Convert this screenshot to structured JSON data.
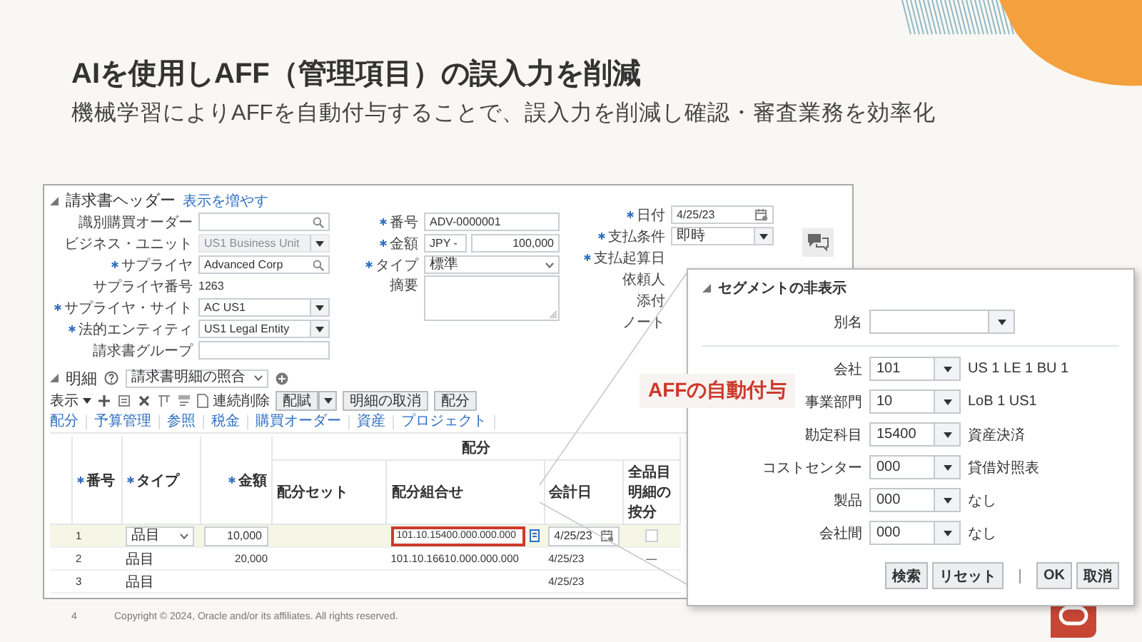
{
  "slide": {
    "title": "AIを使用しAFF（管理項目）の誤入力を削減",
    "subtitle": "機械学習によりAFFを自動付与することで、誤入力を削減し確認・審査業務を効率化"
  },
  "invoice": {
    "header": {
      "title": "請求書ヘッダー",
      "link": "表示を増やす",
      "left_fields": [
        {
          "label": "識別購買オーダー",
          "required": false,
          "kind": "search",
          "disabled": false
        },
        {
          "label": "ビジネス・ユニット",
          "required": false,
          "kind": "select",
          "value": "US1 Business Unit",
          "disabled": true
        },
        {
          "label": "サプライヤ",
          "required": true,
          "kind": "search",
          "value": "Advanced Corp",
          "disabled": false
        },
        {
          "label": "サプライヤ番号",
          "required": false,
          "kind": "text",
          "value": "1263",
          "disabled": false
        },
        {
          "label": "サプライヤ・サイト",
          "required": true,
          "kind": "select",
          "value": "AC US1",
          "disabled": false
        },
        {
          "label": "法的エンティティ",
          "required": true,
          "kind": "select",
          "value": "US1 Legal Entity",
          "disabled": false
        },
        {
          "label": "請求書グループ",
          "required": false,
          "kind": "input",
          "disabled": false
        }
      ],
      "middle_fields": [
        {
          "label": "番号",
          "required": true,
          "kind": "input",
          "value": "ADV-0000001"
        },
        {
          "label": "金額",
          "required": true,
          "kind": "currency",
          "currency": "JPY -",
          "value": "100,000"
        },
        {
          "label": "タイプ",
          "required": true,
          "kind": "dropdown",
          "value": "標準"
        },
        {
          "label": "摘要",
          "required": false,
          "kind": "textarea"
        }
      ],
      "right_fields": [
        {
          "label": "日付",
          "required": true,
          "kind": "date",
          "value": "4/25/23"
        },
        {
          "label": "支払条件",
          "required": true,
          "kind": "select",
          "value": "即時"
        },
        {
          "label": "支払起算日",
          "required": true,
          "kind": "label"
        },
        {
          "label": "依頼人",
          "required": false,
          "kind": "label"
        },
        {
          "label": "添付",
          "required": false,
          "kind": "label"
        },
        {
          "label": "ノート",
          "required": false,
          "kind": "label"
        }
      ]
    },
    "lines": {
      "title": "明細",
      "view_select": "請求書明細の照合",
      "view_menu": "表示",
      "toolbar_action": "連続削除",
      "buttons": [
        {
          "label": "配賦",
          "menu": true
        },
        {
          "label": "明細の取消",
          "menu": false
        },
        {
          "label": "配分",
          "menu": false
        }
      ],
      "tabs": [
        "配分",
        "予算管理",
        "参照",
        "税金",
        "購買オーダー",
        "資産",
        "プロジェクト"
      ],
      "table": {
        "group_heading": "配分",
        "columns": [
          {
            "label": "番号",
            "required": true,
            "group": false
          },
          {
            "label": "タイプ",
            "required": true,
            "group": false
          },
          {
            "label": "金額",
            "required": true,
            "group": false
          },
          {
            "label": "配分セット",
            "required": false,
            "group": true
          },
          {
            "label": "配分組合せ",
            "required": false,
            "group": true
          },
          {
            "label": "会計日",
            "required": false,
            "group": true
          },
          {
            "label": "全品目明細の按分",
            "required": false,
            "group": true
          }
        ],
        "rows": [
          {
            "selected": true,
            "editable": true,
            "number": "1",
            "type": "品目",
            "amount": "10,000",
            "combination": "101.10.15400.000.000.000",
            "highlighted": true,
            "accounting_date": "4/25/23",
            "prorate_checked": false
          },
          {
            "selected": false,
            "editable": false,
            "number": "2",
            "type": "品目",
            "amount": "20,000",
            "combination": "101.10.16610.000.000.000",
            "highlighted": false,
            "accounting_date": "4/25/23",
            "prorate": "—"
          },
          {
            "selected": false,
            "editable": false,
            "number": "3",
            "type": "品目",
            "highlighted": false,
            "accounting_date": "4/25/23"
          }
        ]
      }
    }
  },
  "callout": "AFFの自動付与",
  "popup": {
    "title": "セグメントの非表示",
    "alias_label": "別名",
    "segments": [
      {
        "label": "会社",
        "value": "101",
        "description": "US 1 LE 1 BU 1"
      },
      {
        "label": "事業部門",
        "value": "10",
        "description": "LoB 1 US1"
      },
      {
        "label": "勘定科目",
        "value": "15400",
        "description": "資産決済"
      },
      {
        "label": "コストセンター",
        "value": "000",
        "description": "貸借対照表"
      },
      {
        "label": "製品",
        "value": "000",
        "description": "なし"
      },
      {
        "label": "会社間",
        "value": "000",
        "description": "なし"
      }
    ],
    "buttons": [
      "検索",
      "リセット",
      "OK",
      "取消"
    ]
  },
  "footer": {
    "page": "4",
    "copyright": "Copyright © 2024, Oracle and/or its affiliates. All rights reserved."
  }
}
